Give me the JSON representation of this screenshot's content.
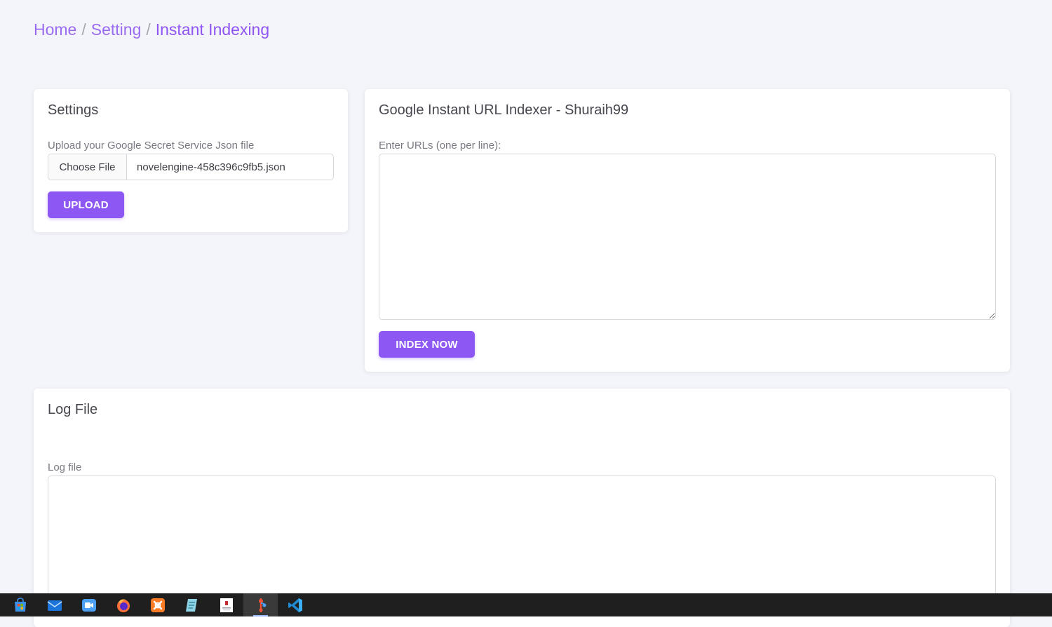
{
  "breadcrumb": {
    "home": "Home",
    "setting": "Setting",
    "current": "Instant Indexing",
    "separator": "/"
  },
  "settings_card": {
    "title": "Settings",
    "upload_label": "Upload your Google Secret Service Json file",
    "choose_file_label": "Choose File",
    "selected_file": "novelengine-458c396c9fb5.json",
    "upload_button": "UPLOAD"
  },
  "indexer_card": {
    "title": "Google Instant URL Indexer - Shuraih99",
    "urls_label": "Enter URLs (one per line):",
    "urls_value": "",
    "index_button": "INDEX NOW"
  },
  "log_card": {
    "title": "Log File",
    "log_label": "Log file",
    "log_value": ""
  },
  "taskbar": {
    "items": [
      {
        "icon": "windows-store-icon"
      },
      {
        "icon": "mail-icon"
      },
      {
        "icon": "video-call-icon"
      },
      {
        "icon": "firefox-icon"
      },
      {
        "icon": "xampp-icon"
      },
      {
        "icon": "notepad-icon"
      },
      {
        "icon": "document-app-icon"
      },
      {
        "icon": "git-tool-icon",
        "active": true
      },
      {
        "icon": "vscode-icon"
      }
    ]
  },
  "colors": {
    "accent": "#8c57f3",
    "breadcrumb": "#9a6cf0",
    "background": "#f4f5fa",
    "taskbar": "#1f1f1f"
  }
}
